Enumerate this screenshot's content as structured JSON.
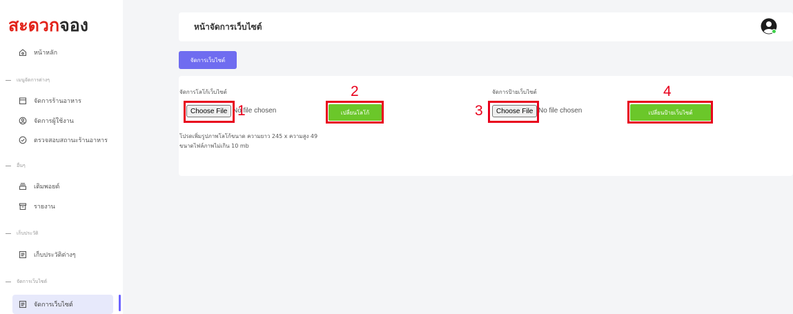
{
  "brand": {
    "logo_part1": "สะดวก",
    "logo_part2": "จอง"
  },
  "sidebar": {
    "home": "หน้าหลัก",
    "sections": [
      {
        "title": "เมนูจัดการต่างๆ",
        "items": [
          "จัดการร้านอาหาร",
          "จัดการผู้ใช้งาน",
          "ตรวจสอบสถานะร้านอาหาร"
        ]
      },
      {
        "title": "อื่นๆ",
        "items": [
          "เติมพอยต์",
          "รายงาน"
        ]
      },
      {
        "title": "เก็บประวัติ",
        "items": [
          "เก็บประวัติต่างๆ"
        ]
      },
      {
        "title": "จัดการเว็บไซต์",
        "items": [
          "จัดการเว็บไซต์"
        ]
      }
    ]
  },
  "header": {
    "title": "หน้าจัดการเว็บไซต์"
  },
  "toolbar": {
    "manage_label": "จัดการเว็บไซต์"
  },
  "logo_upload": {
    "label": "จัดการโลโก้เว็บไซต์",
    "choose_label": "Choose File",
    "file_status": "No file chosen",
    "submit_label": "เปลี่ยนโลโก้"
  },
  "banner_upload": {
    "label": "จัดการป้ายเว็บไซต์",
    "choose_label": "Choose File",
    "file_status": "No file chosen",
    "submit_label": "เปลี่ยนป้ายเว็บไซต์"
  },
  "notes": {
    "line1": "โปรดเพิ่มรูปภาพโลโก้ขนาด ความยาว 245 x ความสูง 49",
    "line2": "ขนาดไฟล์ภาพไม่เกิน 10 mb"
  },
  "annotations": [
    "1",
    "2",
    "3",
    "4"
  ],
  "colors": {
    "brand_red": "#e2231a",
    "accent_purple": "#6f6cf0",
    "action_green": "#6bc72a",
    "annotation_red": "#e8001c"
  }
}
